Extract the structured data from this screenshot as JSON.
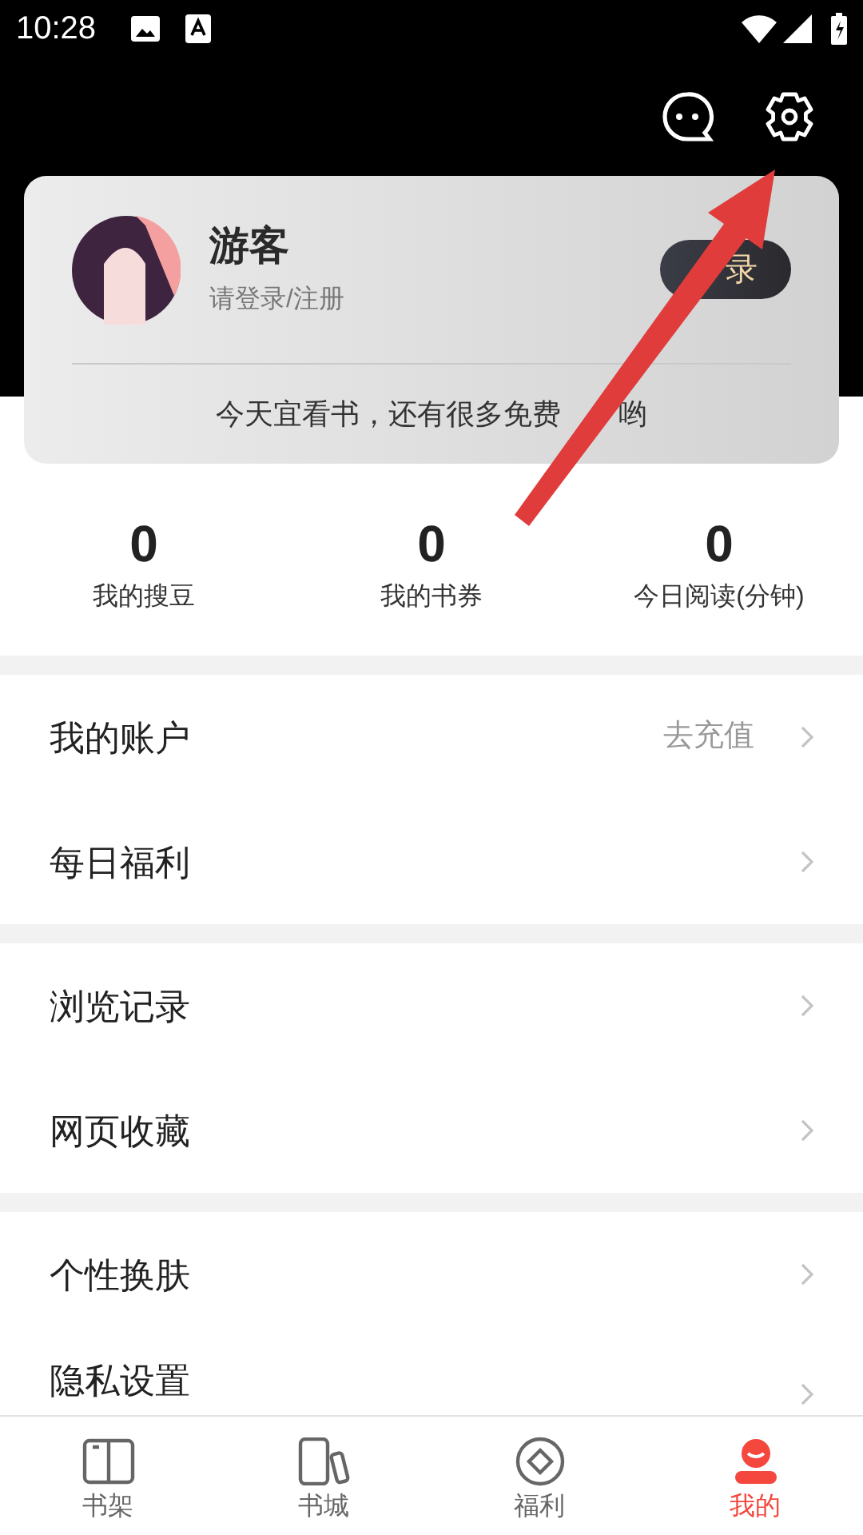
{
  "status_bar": {
    "time": "10:28"
  },
  "profile": {
    "name": "游客",
    "subtitle": "请登录/注册",
    "login_button": "录",
    "tagline": "今天宜看书，还有很多免费",
    "tagline_end": "哟"
  },
  "stats": [
    {
      "value": "0",
      "label": "我的搜豆"
    },
    {
      "value": "0",
      "label": "我的书券"
    },
    {
      "value": "0",
      "label": "今日阅读(分钟)"
    }
  ],
  "menu_groups": [
    [
      {
        "label": "我的账户",
        "value": "去充值"
      },
      {
        "label": "每日福利"
      }
    ],
    [
      {
        "label": "浏览记录"
      },
      {
        "label": "网页收藏"
      }
    ],
    [
      {
        "label": "个性换肤"
      },
      {
        "label": "隐私设置"
      }
    ]
  ],
  "tabs": [
    {
      "label": "书架",
      "kind": "book",
      "selected": false
    },
    {
      "label": "书城",
      "kind": "phone",
      "selected": false
    },
    {
      "label": "福利",
      "kind": "coin",
      "selected": false
    },
    {
      "label": "我的",
      "kind": "person",
      "selected": true
    }
  ]
}
